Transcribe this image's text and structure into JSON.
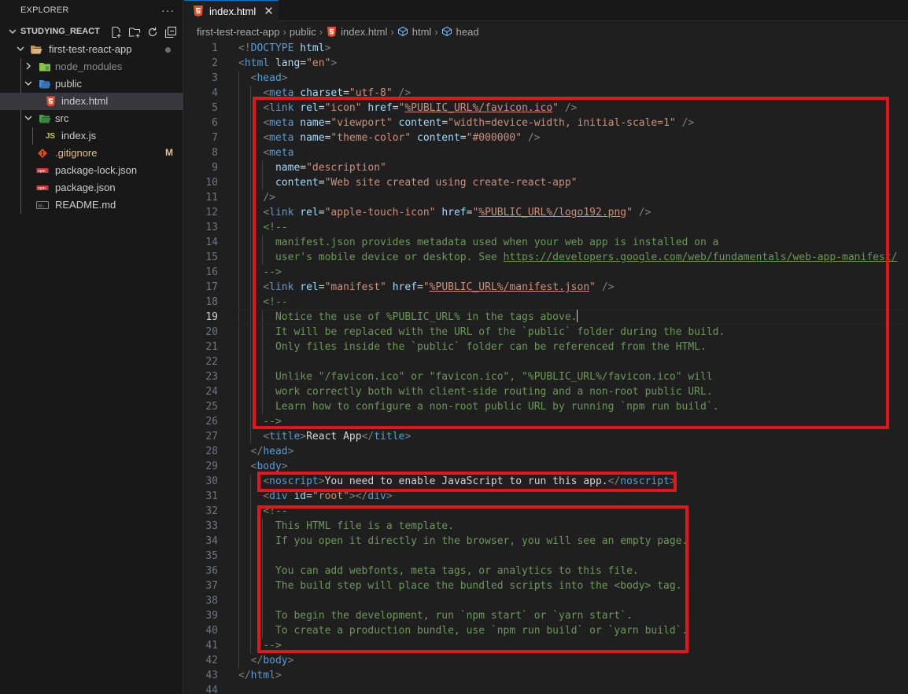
{
  "sidebar": {
    "explorer_title": "EXPLORER",
    "more_label": "···",
    "project": "STUDYING_REACT",
    "tree": [
      {
        "label": "first-test-react-app",
        "type": "folder-open",
        "depth": 1,
        "badge_dot": true
      },
      {
        "label": "node_modules",
        "type": "folder-closed",
        "depth": 2,
        "dim": true
      },
      {
        "label": "public",
        "type": "folder-open",
        "depth": 2
      },
      {
        "label": "index.html",
        "type": "html",
        "depth": 3,
        "selected": true
      },
      {
        "label": "src",
        "type": "folder-open",
        "depth": 2
      },
      {
        "label": "index.js",
        "type": "js",
        "depth": 3
      },
      {
        "label": ".gitignore",
        "type": "git",
        "depth": 2,
        "badge": "M"
      },
      {
        "label": "package-lock.json",
        "type": "npm",
        "depth": 2
      },
      {
        "label": "package.json",
        "type": "npm",
        "depth": 2
      },
      {
        "label": "README.md",
        "type": "md",
        "depth": 2
      }
    ]
  },
  "tab": {
    "label": "index.html",
    "close": "✕"
  },
  "breadcrumb": [
    "first-test-react-app",
    "public",
    "index.html",
    "html",
    "head"
  ],
  "editor": {
    "active_line": 19,
    "lines": [
      [
        [
          "t-tag",
          "<!"
        ],
        [
          "t-name",
          "DOCTYPE"
        ],
        [
          "t-txt",
          " "
        ],
        [
          "t-attr",
          "html"
        ],
        [
          "t-tag",
          ">"
        ]
      ],
      [
        [
          "t-tag",
          "<"
        ],
        [
          "t-name",
          "html"
        ],
        [
          "t-txt",
          " "
        ],
        [
          "t-attr",
          "lang"
        ],
        [
          "t-txt",
          "="
        ],
        [
          "t-str",
          "\"en\""
        ],
        [
          "t-tag",
          ">"
        ]
      ],
      [
        [
          "t-txt",
          "  "
        ],
        [
          "t-tag",
          "<"
        ],
        [
          "t-name",
          "head"
        ],
        [
          "t-tag",
          ">"
        ]
      ],
      [
        [
          "t-txt",
          "    "
        ],
        [
          "t-tag",
          "<"
        ],
        [
          "t-name",
          "meta"
        ],
        [
          "t-txt",
          " "
        ],
        [
          "t-attr",
          "charset"
        ],
        [
          "t-txt",
          "="
        ],
        [
          "t-str",
          "\"utf-8\""
        ],
        [
          "t-txt",
          " "
        ],
        [
          "t-tag",
          "/>"
        ]
      ],
      [
        [
          "t-txt",
          "    "
        ],
        [
          "t-tag",
          "<"
        ],
        [
          "t-name",
          "link"
        ],
        [
          "t-txt",
          " "
        ],
        [
          "t-attr",
          "rel"
        ],
        [
          "t-txt",
          "="
        ],
        [
          "t-str",
          "\"icon\""
        ],
        [
          "t-txt",
          " "
        ],
        [
          "t-attr",
          "href"
        ],
        [
          "t-txt",
          "="
        ],
        [
          "t-str",
          "\""
        ],
        [
          "t-str t-ul",
          "%PUBLIC_URL%/favicon.ico"
        ],
        [
          "t-str",
          "\""
        ],
        [
          "t-txt",
          " "
        ],
        [
          "t-tag",
          "/>"
        ]
      ],
      [
        [
          "t-txt",
          "    "
        ],
        [
          "t-tag",
          "<"
        ],
        [
          "t-name",
          "meta"
        ],
        [
          "t-txt",
          " "
        ],
        [
          "t-attr",
          "name"
        ],
        [
          "t-txt",
          "="
        ],
        [
          "t-str",
          "\"viewport\""
        ],
        [
          "t-txt",
          " "
        ],
        [
          "t-attr",
          "content"
        ],
        [
          "t-txt",
          "="
        ],
        [
          "t-str",
          "\"width=device-width, initial-scale=1\""
        ],
        [
          "t-txt",
          " "
        ],
        [
          "t-tag",
          "/>"
        ]
      ],
      [
        [
          "t-txt",
          "    "
        ],
        [
          "t-tag",
          "<"
        ],
        [
          "t-name",
          "meta"
        ],
        [
          "t-txt",
          " "
        ],
        [
          "t-attr",
          "name"
        ],
        [
          "t-txt",
          "="
        ],
        [
          "t-str",
          "\"theme-color\""
        ],
        [
          "t-txt",
          " "
        ],
        [
          "t-attr",
          "content"
        ],
        [
          "t-txt",
          "="
        ],
        [
          "t-str",
          "\"#000000\""
        ],
        [
          "t-txt",
          " "
        ],
        [
          "t-tag",
          "/>"
        ]
      ],
      [
        [
          "t-txt",
          "    "
        ],
        [
          "t-tag",
          "<"
        ],
        [
          "t-name",
          "meta"
        ]
      ],
      [
        [
          "t-txt",
          "      "
        ],
        [
          "t-attr",
          "name"
        ],
        [
          "t-txt",
          "="
        ],
        [
          "t-str",
          "\"description\""
        ]
      ],
      [
        [
          "t-txt",
          "      "
        ],
        [
          "t-attr",
          "content"
        ],
        [
          "t-txt",
          "="
        ],
        [
          "t-str",
          "\"Web site created using create-react-app\""
        ]
      ],
      [
        [
          "t-txt",
          "    "
        ],
        [
          "t-tag",
          "/>"
        ]
      ],
      [
        [
          "t-txt",
          "    "
        ],
        [
          "t-tag",
          "<"
        ],
        [
          "t-name",
          "link"
        ],
        [
          "t-txt",
          " "
        ],
        [
          "t-attr",
          "rel"
        ],
        [
          "t-txt",
          "="
        ],
        [
          "t-str",
          "\"apple-touch-icon\""
        ],
        [
          "t-txt",
          " "
        ],
        [
          "t-attr",
          "href"
        ],
        [
          "t-txt",
          "="
        ],
        [
          "t-str",
          "\""
        ],
        [
          "t-str t-ul",
          "%PUBLIC_URL%/logo192.png"
        ],
        [
          "t-str",
          "\""
        ],
        [
          "t-txt",
          " "
        ],
        [
          "t-tag",
          "/>"
        ]
      ],
      [
        [
          "t-txt",
          "    "
        ],
        [
          "t-com",
          "<!--"
        ]
      ],
      [
        [
          "t-txt",
          "      "
        ],
        [
          "t-com",
          "manifest.json provides metadata used when your web app is installed on a"
        ]
      ],
      [
        [
          "t-txt",
          "      "
        ],
        [
          "t-com",
          "user's mobile device or desktop. See "
        ],
        [
          "t-link",
          "https://developers.google.com/web/fundamentals/web-app-manifest/"
        ]
      ],
      [
        [
          "t-txt",
          "    "
        ],
        [
          "t-com",
          "-->"
        ]
      ],
      [
        [
          "t-txt",
          "    "
        ],
        [
          "t-tag",
          "<"
        ],
        [
          "t-name",
          "link"
        ],
        [
          "t-txt",
          " "
        ],
        [
          "t-attr",
          "rel"
        ],
        [
          "t-txt",
          "="
        ],
        [
          "t-str",
          "\"manifest\""
        ],
        [
          "t-txt",
          " "
        ],
        [
          "t-attr",
          "href"
        ],
        [
          "t-txt",
          "="
        ],
        [
          "t-str",
          "\""
        ],
        [
          "t-str t-ul",
          "%PUBLIC_URL%/manifest.json"
        ],
        [
          "t-str",
          "\""
        ],
        [
          "t-txt",
          " "
        ],
        [
          "t-tag",
          "/>"
        ]
      ],
      [
        [
          "t-txt",
          "    "
        ],
        [
          "t-com",
          "<!--"
        ]
      ],
      [
        [
          "t-txt",
          "      "
        ],
        [
          "t-com",
          "Notice the use of %PUBLIC_URL% in the tags above."
        ]
      ],
      [
        [
          "t-txt",
          "      "
        ],
        [
          "t-com",
          "It will be replaced with the URL of the `public` folder during the build."
        ]
      ],
      [
        [
          "t-txt",
          "      "
        ],
        [
          "t-com",
          "Only files inside the `public` folder can be referenced from the HTML."
        ]
      ],
      [],
      [
        [
          "t-txt",
          "      "
        ],
        [
          "t-com",
          "Unlike \"/favicon.ico\" or \"favicon.ico\", \"%PUBLIC_URL%/favicon.ico\" will"
        ]
      ],
      [
        [
          "t-txt",
          "      "
        ],
        [
          "t-com",
          "work correctly both with client-side routing and a non-root public URL."
        ]
      ],
      [
        [
          "t-txt",
          "      "
        ],
        [
          "t-com",
          "Learn how to configure a non-root public URL by running `npm run build`."
        ]
      ],
      [
        [
          "t-txt",
          "    "
        ],
        [
          "t-com",
          "-->"
        ]
      ],
      [
        [
          "t-txt",
          "    "
        ],
        [
          "t-tag",
          "<"
        ],
        [
          "t-name",
          "title"
        ],
        [
          "t-tag",
          ">"
        ],
        [
          "t-txt",
          "React App"
        ],
        [
          "t-tag",
          "</"
        ],
        [
          "t-name",
          "title"
        ],
        [
          "t-tag",
          ">"
        ]
      ],
      [
        [
          "t-txt",
          "  "
        ],
        [
          "t-tag",
          "</"
        ],
        [
          "t-name",
          "head"
        ],
        [
          "t-tag",
          ">"
        ]
      ],
      [
        [
          "t-txt",
          "  "
        ],
        [
          "t-tag",
          "<"
        ],
        [
          "t-name",
          "body"
        ],
        [
          "t-tag",
          ">"
        ]
      ],
      [
        [
          "t-txt",
          "    "
        ],
        [
          "t-tag",
          "<"
        ],
        [
          "t-name",
          "noscript"
        ],
        [
          "t-tag",
          ">"
        ],
        [
          "t-txt",
          "You need to enable JavaScript to run this app."
        ],
        [
          "t-tag",
          "</"
        ],
        [
          "t-name",
          "noscript"
        ],
        [
          "t-tag",
          ">"
        ]
      ],
      [
        [
          "t-txt",
          "    "
        ],
        [
          "t-tag",
          "<"
        ],
        [
          "t-name",
          "div"
        ],
        [
          "t-txt",
          " "
        ],
        [
          "t-attr",
          "id"
        ],
        [
          "t-txt",
          "="
        ],
        [
          "t-str",
          "\"root\""
        ],
        [
          "t-tag",
          "></"
        ],
        [
          "t-name",
          "div"
        ],
        [
          "t-tag",
          ">"
        ]
      ],
      [
        [
          "t-txt",
          "    "
        ],
        [
          "t-com",
          "<!--"
        ]
      ],
      [
        [
          "t-txt",
          "      "
        ],
        [
          "t-com",
          "This HTML file is a template."
        ]
      ],
      [
        [
          "t-txt",
          "      "
        ],
        [
          "t-com",
          "If you open it directly in the browser, you will see an empty page."
        ]
      ],
      [],
      [
        [
          "t-txt",
          "      "
        ],
        [
          "t-com",
          "You can add webfonts, meta tags, or analytics to this file."
        ]
      ],
      [
        [
          "t-txt",
          "      "
        ],
        [
          "t-com",
          "The build step will place the bundled scripts into the <body> tag."
        ]
      ],
      [],
      [
        [
          "t-txt",
          "      "
        ],
        [
          "t-com",
          "To begin the development, run `npm start` or `yarn start`."
        ]
      ],
      [
        [
          "t-txt",
          "      "
        ],
        [
          "t-com",
          "To create a production bundle, use `npm run build` or `yarn build`."
        ]
      ],
      [
        [
          "t-txt",
          "    "
        ],
        [
          "t-com",
          "-->"
        ]
      ],
      [
        [
          "t-txt",
          "  "
        ],
        [
          "t-tag",
          "</"
        ],
        [
          "t-name",
          "body"
        ],
        [
          "t-tag",
          ">"
        ]
      ],
      [
        [
          "t-tag",
          "</"
        ],
        [
          "t-name",
          "html"
        ],
        [
          "t-tag",
          ">"
        ]
      ],
      []
    ]
  },
  "colors": {
    "annotation": "#e5141d",
    "accent": "#0078d4",
    "comment": "#6a9955"
  }
}
